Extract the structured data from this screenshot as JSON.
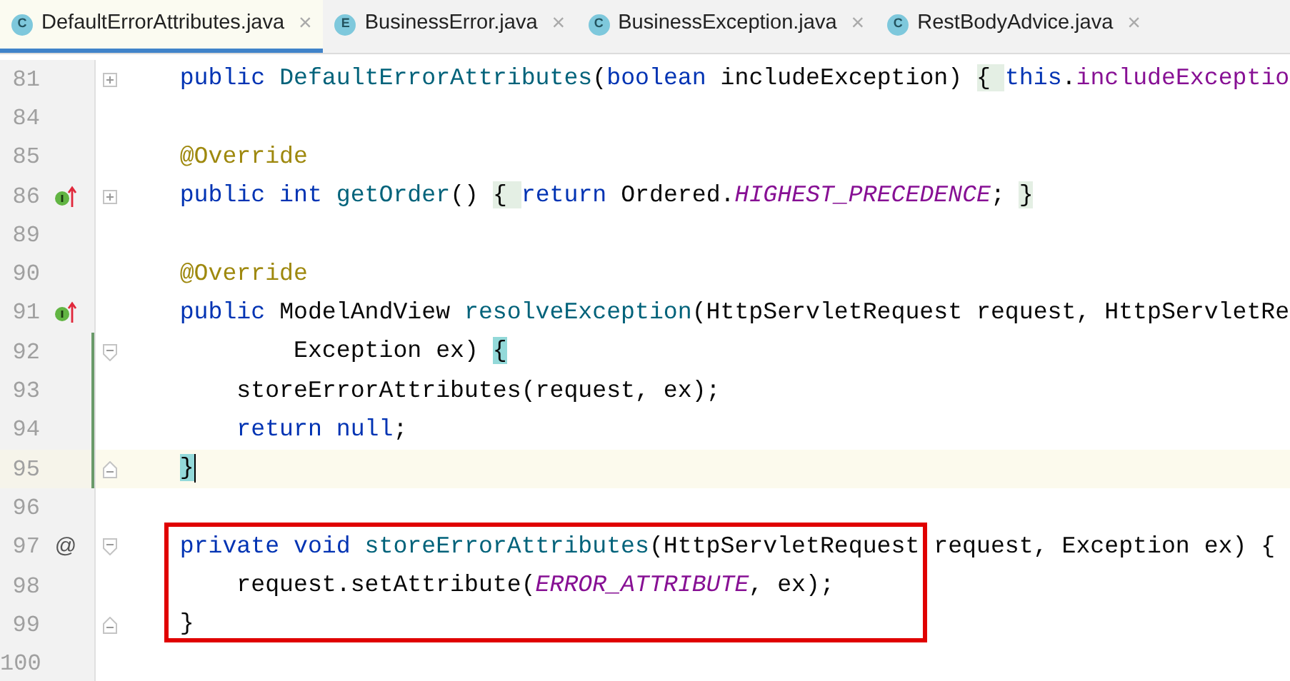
{
  "tabs": [
    {
      "icon_letter": "C",
      "label": "DefaultErrorAttributes.java",
      "close": "×",
      "selected": true
    },
    {
      "icon_letter": "E",
      "label": "BusinessError.java",
      "close": "×",
      "selected": false
    },
    {
      "icon_letter": "C",
      "label": "BusinessException.java",
      "close": "×",
      "selected": false
    },
    {
      "icon_letter": "C",
      "label": "RestBodyAdvice.java",
      "close": "×",
      "selected": false
    }
  ],
  "editor": {
    "lines": [
      {
        "number": "81",
        "fold": {
          "kind": "plus"
        },
        "changed": false,
        "current": false,
        "boxed": false,
        "tokens": [
          {
            "t": "    public ",
            "kind": "kw"
          },
          {
            "t": "DefaultErrorAttributes",
            "kind": "fn"
          },
          {
            "t": "(",
            "kind": "plain"
          },
          {
            "t": "boolean ",
            "kind": "kw"
          },
          {
            "t": "includeException) ",
            "kind": "plain"
          },
          {
            "t": "{ ",
            "kind": "folded"
          },
          {
            "t": "this",
            "kind": "kw"
          },
          {
            "t": ".",
            "kind": "plain"
          },
          {
            "t": "includeExceptio",
            "kind": "field"
          }
        ]
      },
      {
        "number": "84",
        "changed": false,
        "current": false,
        "boxed": false
      },
      {
        "number": "85",
        "changed": false,
        "current": false,
        "boxed": false,
        "tokens": [
          {
            "t": "    @Override",
            "kind": "ann"
          }
        ]
      },
      {
        "number": "86",
        "gutter": {
          "kind": "override"
        },
        "fold": {
          "kind": "plus"
        },
        "changed": false,
        "current": false,
        "boxed": false,
        "tokens": [
          {
            "t": "    public int ",
            "kind": "kw"
          },
          {
            "t": "getOrder",
            "kind": "fn"
          },
          {
            "t": "() ",
            "kind": "plain"
          },
          {
            "t": "{ ",
            "kind": "folded"
          },
          {
            "t": "return ",
            "kind": "kw"
          },
          {
            "t": "Ordered.",
            "kind": "plain"
          },
          {
            "t": "HIGHEST_PRECEDENCE",
            "kind": "const"
          },
          {
            "t": "; ",
            "kind": "plain"
          },
          {
            "t": "}",
            "kind": "folded"
          }
        ]
      },
      {
        "number": "89",
        "changed": false,
        "current": false,
        "boxed": false
      },
      {
        "number": "90",
        "changed": false,
        "current": false,
        "boxed": false,
        "tokens": [
          {
            "t": "    @Override",
            "kind": "ann"
          }
        ]
      },
      {
        "number": "91",
        "gutter": {
          "kind": "override"
        },
        "changed": false,
        "current": false,
        "boxed": false,
        "tokens": [
          {
            "t": "    public ",
            "kind": "kw"
          },
          {
            "t": "ModelAndView ",
            "kind": "plain"
          },
          {
            "t": "resolveException",
            "kind": "fn"
          },
          {
            "t": "(HttpServletRequest request, HttpServletRe",
            "kind": "plain"
          }
        ]
      },
      {
        "number": "92",
        "fold": {
          "kind": "open"
        },
        "changed": true,
        "current": false,
        "boxed": false,
        "tokens": [
          {
            "t": "            Exception ex) ",
            "kind": "plain"
          },
          {
            "t": "{",
            "kind": "brace"
          }
        ]
      },
      {
        "number": "93",
        "changed": true,
        "current": false,
        "boxed": false,
        "tokens": [
          {
            "t": "        storeErrorAttributes(request, ex);",
            "kind": "plain"
          }
        ]
      },
      {
        "number": "94",
        "changed": true,
        "current": false,
        "boxed": false,
        "tokens": [
          {
            "t": "        return null",
            "kind": "kw"
          },
          {
            "t": ";",
            "kind": "plain"
          }
        ]
      },
      {
        "number": "95",
        "fold": {
          "kind": "close"
        },
        "changed": true,
        "current": true,
        "boxed": false,
        "tokens": [
          {
            "t": "    }",
            "kind": "brace"
          }
        ]
      },
      {
        "number": "96",
        "changed": false,
        "current": false,
        "boxed": false
      },
      {
        "number": "97",
        "gutter": {
          "kind": "glyph",
          "text": "@"
        },
        "fold": {
          "kind": "open"
        },
        "changed": false,
        "current": false,
        "boxed": true,
        "tokens": [
          {
            "t": "    private void ",
            "kind": "kw"
          },
          {
            "t": "storeErrorAttributes",
            "kind": "fn"
          },
          {
            "t": "(HttpServletRequest request, Exception ex) {",
            "kind": "plain"
          }
        ]
      },
      {
        "number": "98",
        "changed": false,
        "current": false,
        "boxed": true,
        "tokens": [
          {
            "t": "        request.setAttribute(",
            "kind": "plain"
          },
          {
            "t": "ERROR_ATTRIBUTE",
            "kind": "const"
          },
          {
            "t": ", ex);",
            "kind": "plain"
          }
        ]
      },
      {
        "number": "99",
        "fold": {
          "kind": "close"
        },
        "changed": false,
        "current": false,
        "boxed": true,
        "tokens": [
          {
            "t": "    }",
            "kind": "plain"
          }
        ]
      },
      {
        "number": "100",
        "changed": false,
        "current": false,
        "boxed": false
      }
    ]
  }
}
